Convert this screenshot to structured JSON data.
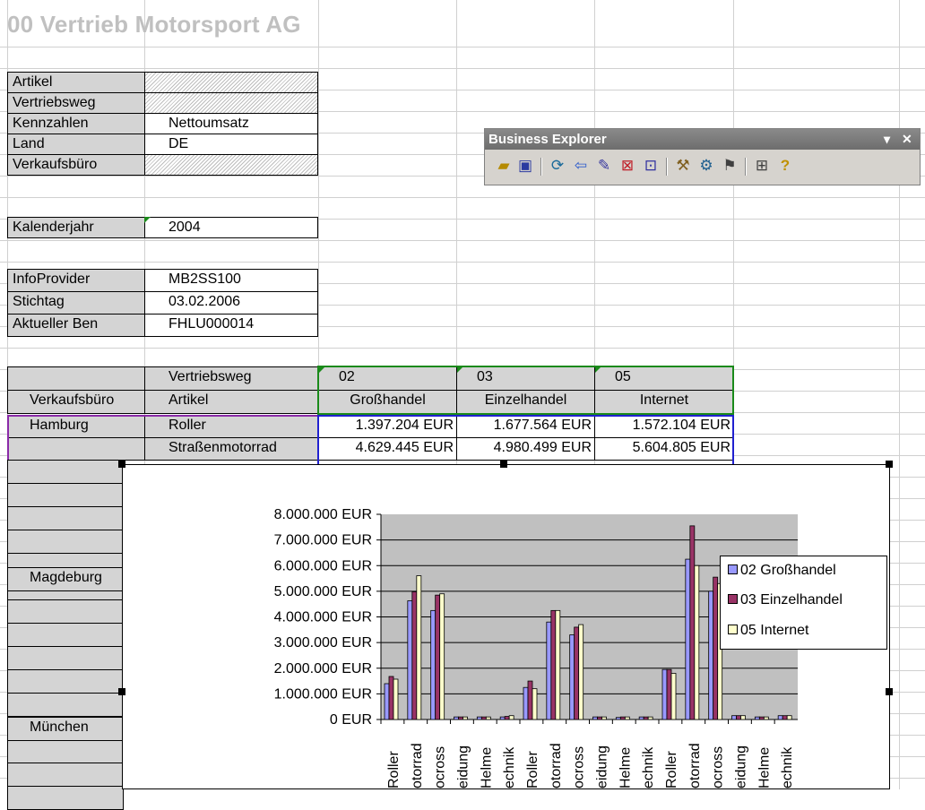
{
  "title": "00 Vertrieb Motorsport AG",
  "filters": [
    {
      "label": "Artikel",
      "value": "",
      "hatched": true
    },
    {
      "label": "Vertriebsweg",
      "value": "",
      "hatched": true
    },
    {
      "label": "Kennzahlen",
      "value": "Nettoumsatz",
      "hatched": false
    },
    {
      "label": "Land",
      "value": "DE",
      "hatched": false
    },
    {
      "label": "Verkaufsbüro",
      "value": "",
      "hatched": true
    }
  ],
  "calendar": {
    "label": "Kalenderjahr",
    "value": "2004"
  },
  "info": [
    {
      "label": "InfoProvider",
      "value": "MB2SS100"
    },
    {
      "label": "Stichtag",
      "value": "03.02.2006"
    },
    {
      "label": "Aktueller Ben",
      "value": "FHLU000014"
    }
  ],
  "table": {
    "dim1_label": "Vertriebsweg",
    "row_header": "Verkaufsbüro",
    "dim2_label": "Artikel",
    "columns": [
      {
        "code": "02",
        "name": "Großhandel"
      },
      {
        "code": "03",
        "name": "Einzelhandel"
      },
      {
        "code": "05",
        "name": "Internet"
      }
    ],
    "rows": [
      {
        "office": "Hamburg",
        "article": "Roller",
        "values": [
          "1.397.204 EUR",
          "1.677.564 EUR",
          "1.572.104 EUR"
        ]
      },
      {
        "office": "",
        "article": "Straßenmotorrad",
        "values": [
          "4.629.445 EUR",
          "4.980.499 EUR",
          "5.604.805 EUR"
        ]
      }
    ],
    "offices_lower": [
      "Magdeburg",
      "München"
    ]
  },
  "business_explorer": {
    "title": "Business Explorer",
    "tools": [
      "open-icon",
      "save-icon",
      "refresh-icon",
      "back-icon",
      "change-query-icon",
      "goto-icon",
      "export-icon",
      "tools-icon",
      "global-settings-icon",
      "format-icon",
      "layout-icon",
      "help-icon"
    ]
  },
  "chart_data": {
    "type": "bar",
    "ylim": [
      0,
      8000000
    ],
    "ytick_labels": [
      "8.000.000 EUR",
      "7.000.000 EUR",
      "6.000.000 EUR",
      "5.000.000 EUR",
      "4.000.000 EUR",
      "3.000.000 EUR",
      "2.000.000 EUR",
      "1.000.000 EUR",
      "0 EUR"
    ],
    "category_labels": [
      "Roller",
      "otorrad",
      "ocross",
      "eidung",
      "Helme",
      "echnik",
      "Roller",
      "otorrad",
      "ocross",
      "eidung",
      "Helme",
      "echnik",
      "Roller",
      "otorrad",
      "ocross",
      "eidung",
      "Helme",
      "echnik"
    ],
    "series": [
      {
        "name": "02 Großhandel",
        "color": "#9999ff",
        "values": [
          1397204,
          4629445,
          4250000,
          100000,
          100000,
          100000,
          1250000,
          3800000,
          3300000,
          100000,
          80000,
          100000,
          1950000,
          6250000,
          5000000,
          150000,
          100000,
          150000
        ]
      },
      {
        "name": "03 Einzelhandel",
        "color": "#993366",
        "values": [
          1677564,
          4980499,
          4850000,
          100000,
          100000,
          120000,
          1500000,
          4250000,
          3600000,
          100000,
          100000,
          100000,
          1950000,
          7550000,
          5550000,
          150000,
          100000,
          150000
        ]
      },
      {
        "name": "05 Internet",
        "color": "#ffffcc",
        "values": [
          1572104,
          5604805,
          4900000,
          100000,
          100000,
          150000,
          1200000,
          4250000,
          3700000,
          100000,
          100000,
          100000,
          1800000,
          6000000,
          5300000,
          150000,
          100000,
          150000
        ]
      }
    ],
    "plot_bg": "#c0c0c0",
    "legend_position": "right"
  }
}
